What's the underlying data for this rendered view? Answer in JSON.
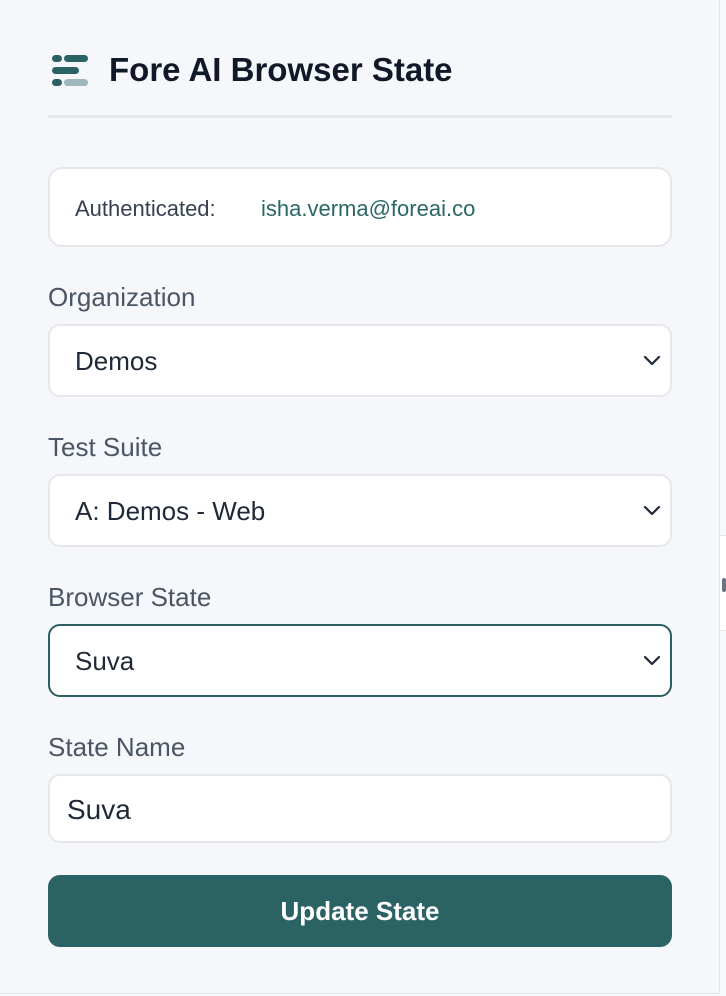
{
  "app": {
    "title": "Fore AI Browser State",
    "logo_icon": "fore-ai-logo-icon",
    "accent_color": "#2b6264",
    "email_color": "#2b6666"
  },
  "auth": {
    "label": "Authenticated:",
    "email": "isha.verma@foreai.co"
  },
  "fields": {
    "organization": {
      "label": "Organization",
      "selected": "Demos"
    },
    "test_suite": {
      "label": "Test Suite",
      "selected": "A: Demos - Web"
    },
    "browser_state": {
      "label": "Browser State",
      "selected": "Suva"
    },
    "state_name": {
      "label": "State Name",
      "value": "Suva"
    }
  },
  "actions": {
    "update_state": "Update State"
  }
}
